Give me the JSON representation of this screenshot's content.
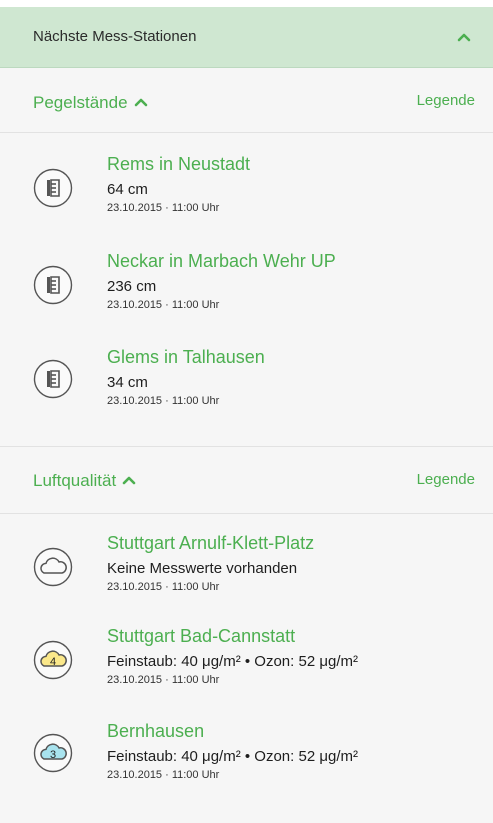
{
  "panel": {
    "title": "Nächste Mess-Stationen"
  },
  "pegel": {
    "title": "Pegelstände",
    "legend": "Legende",
    "items": [
      {
        "name": "Rems in Neustadt",
        "value": "64 cm",
        "time": "23.10.2015 · 11:00 Uhr",
        "icon": "water-gauge-icon"
      },
      {
        "name": "Neckar in Marbach Wehr UP",
        "value": "236 cm",
        "time": "23.10.2015 · 11:00 Uhr",
        "icon": "water-gauge-icon"
      },
      {
        "name": "Glems in Talhausen",
        "value": "34 cm",
        "time": "23.10.2015 · 11:00 Uhr",
        "icon": "water-gauge-icon"
      }
    ]
  },
  "luft": {
    "title": "Luftqualität",
    "legend": "Legende",
    "items": [
      {
        "name": "Stuttgart Arnulf-Klett-Platz",
        "value": "Keine Messwerte vorhanden",
        "time": "23.10.2015 · 11:00 Uhr",
        "icon": "cloud-icon",
        "badge": "",
        "color": "#ffffff"
      },
      {
        "name": "Stuttgart Bad-Cannstatt",
        "value": "Feinstaub: 40 μg/m² • Ozon: 52 μg/m²",
        "time": "23.10.2015 · 11:00 Uhr",
        "icon": "air-quality-cloud-icon",
        "badge": "4",
        "color": "#fbe88a"
      },
      {
        "name": "Bernhausen",
        "value": "Feinstaub: 40 μg/m² • Ozon: 52 μg/m²",
        "time": "23.10.2015 · 11:00 Uhr",
        "icon": "air-quality-cloud-icon",
        "badge": "3",
        "color": "#a8e3ee"
      }
    ]
  },
  "colors": {
    "accent": "#4caf50",
    "header_bg": "#cfe7d1",
    "panel_bg": "#f6f6f6"
  }
}
